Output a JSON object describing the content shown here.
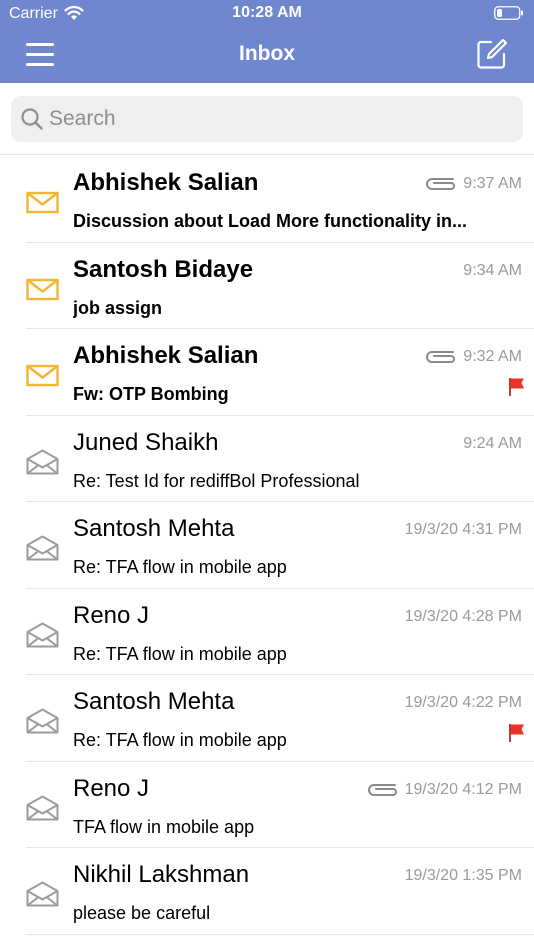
{
  "status_bar": {
    "carrier": "Carrier",
    "time": "10:28 AM"
  },
  "nav": {
    "title": "Inbox"
  },
  "search": {
    "placeholder": "Search"
  },
  "colors": {
    "header": "#6f87cf",
    "unread_envelope": "#f2b534",
    "read_envelope": "#9b9b9b",
    "flag": "#e8332a"
  },
  "emails": [
    {
      "sender": "Abhishek Salian",
      "subject": "Discussion about Load More functionality in...",
      "date": "9:37 AM",
      "unread": true,
      "attachment": true,
      "flagged": false
    },
    {
      "sender": "Santosh Bidaye",
      "subject": "job assign",
      "date": "9:34 AM",
      "unread": true,
      "attachment": false,
      "flagged": false
    },
    {
      "sender": "Abhishek Salian",
      "subject": "Fw: OTP Bombing",
      "date": "9:32 AM",
      "unread": true,
      "attachment": true,
      "flagged": true
    },
    {
      "sender": "Juned Shaikh",
      "subject": "Re: Test Id for rediffBol Professional",
      "date": "9:24 AM",
      "unread": false,
      "attachment": false,
      "flagged": false
    },
    {
      "sender": "Santosh Mehta",
      "subject": "Re: TFA flow in mobile app",
      "date": "19/3/20 4:31 PM",
      "unread": false,
      "attachment": false,
      "flagged": false
    },
    {
      "sender": "Reno J",
      "subject": "Re: TFA flow in mobile app",
      "date": "19/3/20 4:28 PM",
      "unread": false,
      "attachment": false,
      "flagged": false
    },
    {
      "sender": "Santosh Mehta",
      "subject": "Re: TFA flow in mobile app",
      "date": "19/3/20 4:22 PM",
      "unread": false,
      "attachment": false,
      "flagged": true
    },
    {
      "sender": "Reno J",
      "subject": "TFA flow in mobile app",
      "date": "19/3/20 4:12 PM",
      "unread": false,
      "attachment": true,
      "flagged": false
    },
    {
      "sender": "Nikhil Lakshman",
      "subject": "please be careful",
      "date": "19/3/20 1:35 PM",
      "unread": false,
      "attachment": false,
      "flagged": false
    }
  ]
}
